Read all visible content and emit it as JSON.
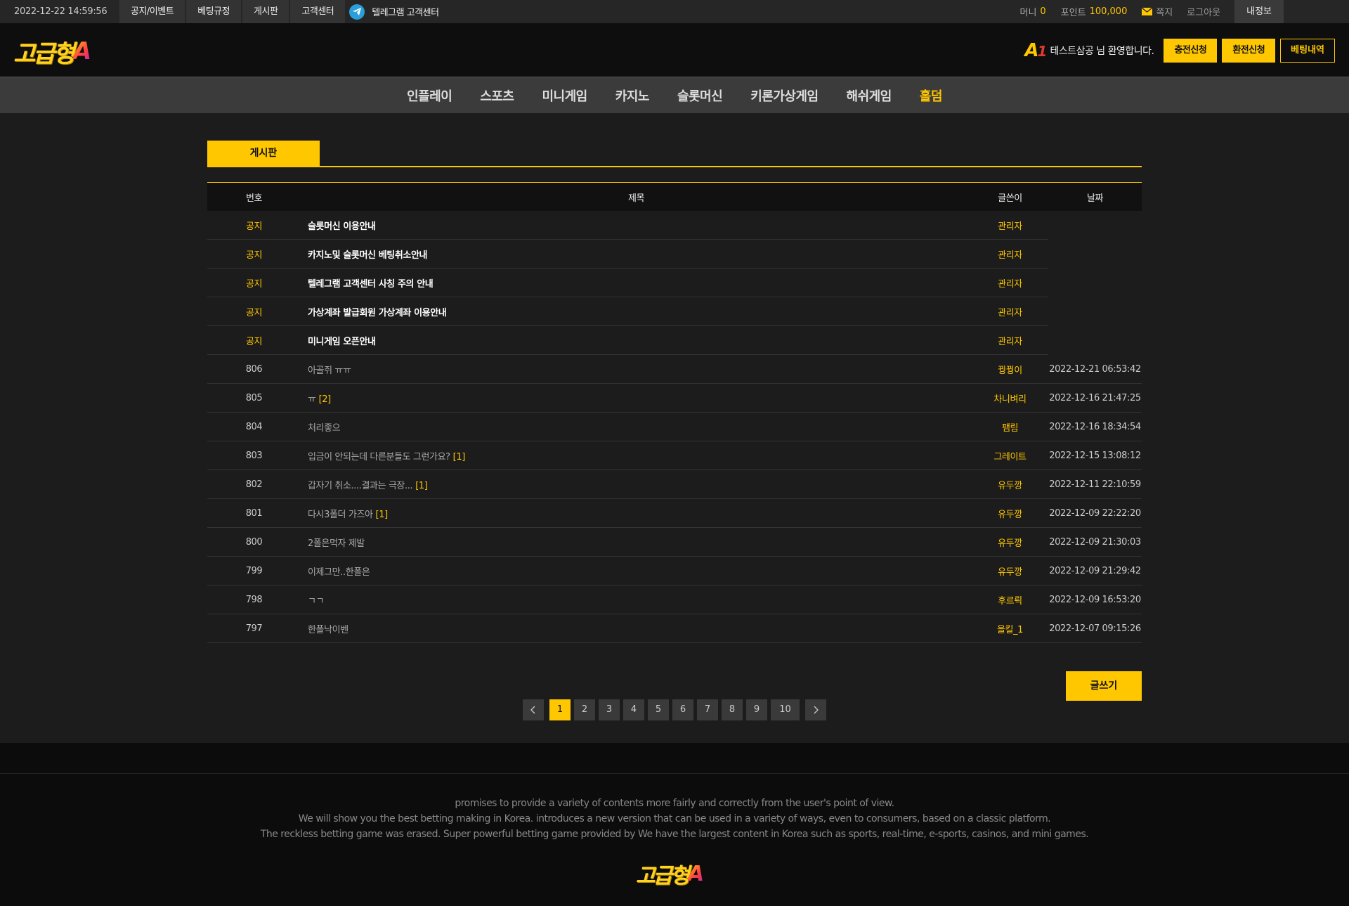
{
  "topbar": {
    "clock": "2022-12-22 14:59:56",
    "links": [
      "공지/이벤트",
      "베팅규정",
      "게시판",
      "고객센터"
    ],
    "telegram": "텔레그램 고객센터",
    "money_label": "머니",
    "money_value": "0",
    "point_label": "포인트",
    "point_value": "100,000",
    "mail": "쪽지",
    "logout": "로그아웃",
    "myinfo": "내정보"
  },
  "header": {
    "logo_text": "고급형",
    "logo_a": "A",
    "badge": "A",
    "badge_num": "1",
    "welcome": "테스트삼공 님 환영합니다.",
    "charge": "충전신청",
    "exchange": "환전신청",
    "bet_history": "베팅내역"
  },
  "nav": [
    "인플레이",
    "스포츠",
    "미니게임",
    "카지노",
    "슬롯머신",
    "키론가상게임",
    "해쉬게임",
    "홀덤"
  ],
  "board": {
    "tab": "게시판",
    "columns": {
      "no": "번호",
      "title": "제목",
      "writer": "글쓴이",
      "date": "날짜"
    },
    "notices": [
      {
        "no": "공지",
        "title": "슬롯머신 이용안내",
        "writer": "관리자"
      },
      {
        "no": "공지",
        "title": "카지노및 슬롯머신 베팅취소안내",
        "writer": "관리자"
      },
      {
        "no": "공지",
        "title": "텔레그램 고객센터 사칭 주의 안내",
        "writer": "관리자"
      },
      {
        "no": "공지",
        "title": "가상계좌 발급회원 가상계좌 이용안내",
        "writer": "관리자"
      },
      {
        "no": "공지",
        "title": "미니게임 오픈안내",
        "writer": "관리자"
      }
    ],
    "posts": [
      {
        "no": "806",
        "title": "아골쥐 ㅠㅠ",
        "comments": "",
        "writer": "꿩꿩이",
        "date": "2022-12-21 06:53:42"
      },
      {
        "no": "805",
        "title": "ㅠ",
        "comments": "[2]",
        "writer": "차니벼리",
        "date": "2022-12-16 21:47:25"
      },
      {
        "no": "804",
        "title": "처리좋으",
        "comments": "",
        "writer": "팸림",
        "date": "2022-12-16 18:34:54"
      },
      {
        "no": "803",
        "title": "입금이 안되는데 다른분들도 그런가요?",
        "comments": "[1]",
        "writer": "그레이트",
        "date": "2022-12-15 13:08:12"
      },
      {
        "no": "802",
        "title": "갑자기 취소....결과는 극장...",
        "comments": "[1]",
        "writer": "유두깡",
        "date": "2022-12-11 22:10:59"
      },
      {
        "no": "801",
        "title": "다시3폴더 가즈아",
        "comments": "[1]",
        "writer": "유두깡",
        "date": "2022-12-09 22:22:20"
      },
      {
        "no": "800",
        "title": "2폴은먹자 제발",
        "comments": "",
        "writer": "유두깡",
        "date": "2022-12-09 21:30:03"
      },
      {
        "no": "799",
        "title": "이제그만..한폴은",
        "comments": "",
        "writer": "유두깡",
        "date": "2022-12-09 21:29:42"
      },
      {
        "no": "798",
        "title": "ㄱㄱ",
        "comments": "",
        "writer": "후르릑",
        "date": "2022-12-09 16:53:20"
      },
      {
        "no": "797",
        "title": "한폴낙이벤",
        "comments": "",
        "writer": "올킬_1",
        "date": "2022-12-07 09:15:26"
      }
    ],
    "write": "글쓰기",
    "pages": [
      "1",
      "2",
      "3",
      "4",
      "5",
      "6",
      "7",
      "8",
      "9",
      "10"
    ],
    "current_page": "1"
  },
  "footer": {
    "lines": [
      "promises to provide a variety of contents more fairly and correctly from the user's point of view.",
      "We will show you the best betting making in Korea. introduces a new version that can be used in a variety of ways, even to consumers, based on a classic platform.",
      "The reckless betting game was erased. Super powerful betting game provided by  We have the largest content in Korea such as sports, real-time, e-sports, casinos, and mini games."
    ],
    "logo_text": "고급형",
    "logo_a": "A"
  },
  "colors": {
    "accent": "#ffc700",
    "background": "#1c1c1c",
    "nav": "#3b3b3b"
  }
}
